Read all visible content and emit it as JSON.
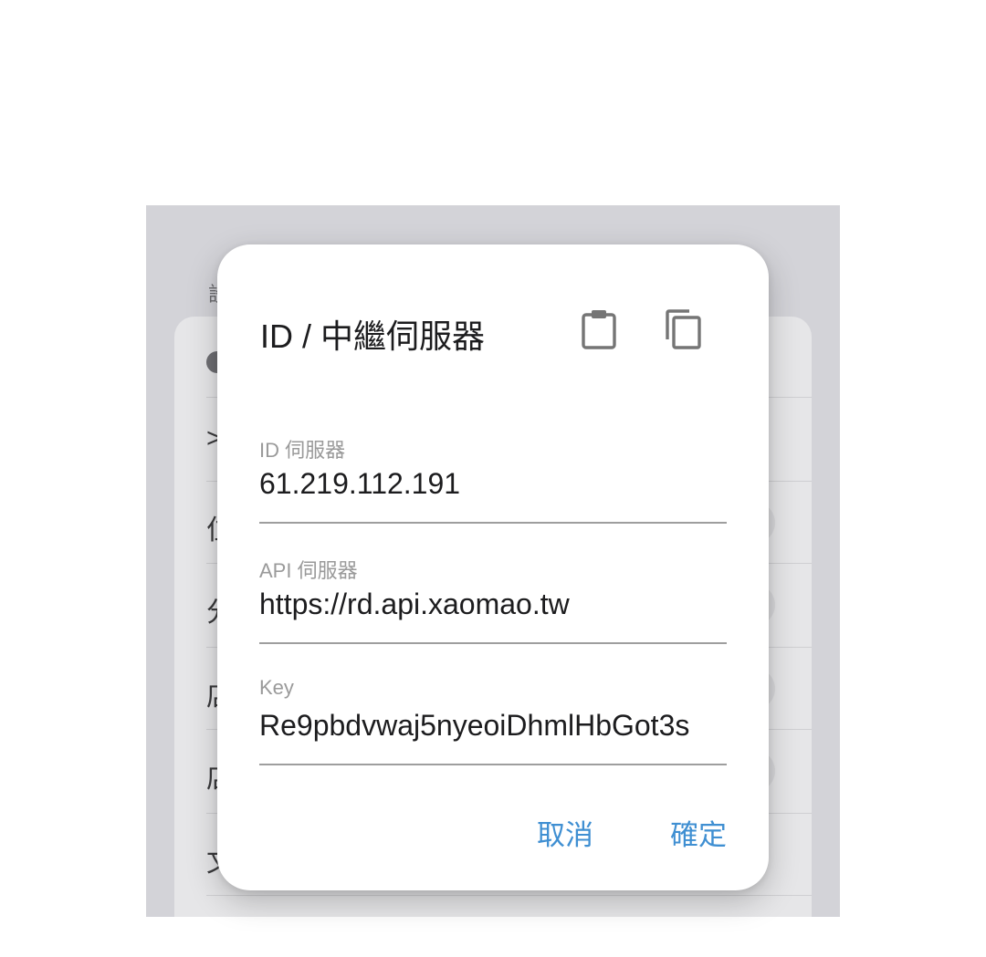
{
  "dialog": {
    "title": "ID / 中繼伺服器",
    "icons": {
      "paste": "clipboard-icon",
      "copy": "copy-icon"
    },
    "fields": [
      {
        "label": "ID 伺服器",
        "value": "61.219.112.191"
      },
      {
        "label": "API 伺服器",
        "value": "https://rd.api.xaomao.tw"
      },
      {
        "label": "Key",
        "value": "Re9pbdvwaj5nyeoiDhmlHbGot3s"
      }
    ],
    "cancel_label": "取消",
    "confirm_label": "確定"
  },
  "background": {
    "section_label": "設",
    "row_glyphs": [
      ">",
      "位",
      "分",
      "店",
      "店",
      "文"
    ]
  },
  "colors": {
    "accent": "#3f8fd2",
    "overlay": "#d3d3d8",
    "divider": "#9e9e9e"
  }
}
